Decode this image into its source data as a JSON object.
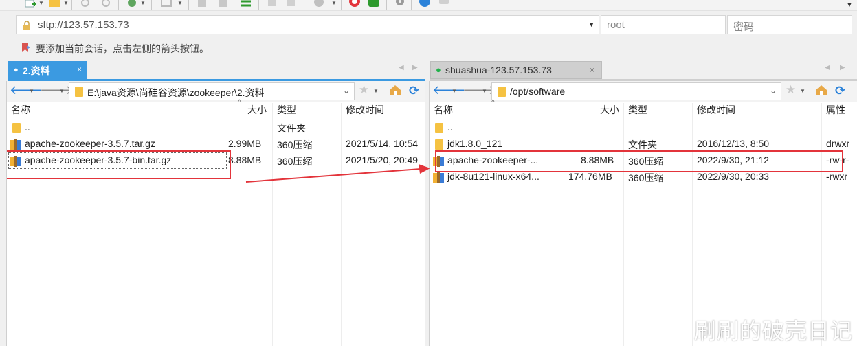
{
  "session": {
    "address": "sftp://123.57.153.73",
    "user_placeholder": "root",
    "password_placeholder": "密码",
    "hint": "要添加当前会话，点击左侧的箭头按钮。"
  },
  "tabs": {
    "left": {
      "label": "2.资料",
      "close": "×"
    },
    "right": {
      "label": "shuashua-123.57.153.73",
      "close": "×"
    }
  },
  "left_pane": {
    "path": "E:\\java资源\\尚硅谷资源\\zookeeper\\2.资料",
    "columns": {
      "name": "名称",
      "size": "大小",
      "type": "类型",
      "modified": "修改时间"
    },
    "rows": [
      {
        "name": "..",
        "size": "",
        "type": "文件夹",
        "modified": "",
        "icon": "folder"
      },
      {
        "name": "apache-zookeeper-3.5.7.tar.gz",
        "size": "2.99MB",
        "type": "360压缩",
        "modified": "2021/5/14, 10:54",
        "icon": "archive"
      },
      {
        "name": "apache-zookeeper-3.5.7-bin.tar.gz",
        "size": "8.88MB",
        "type": "360压缩",
        "modified": "2021/5/20, 20:49",
        "icon": "archive"
      }
    ]
  },
  "right_pane": {
    "path": "/opt/software",
    "columns": {
      "name": "名称",
      "size": "大小",
      "type": "类型",
      "modified": "修改时间",
      "attrs": "属性"
    },
    "rows": [
      {
        "name": "..",
        "size": "",
        "type": "",
        "modified": "",
        "attrs": "",
        "icon": "folder"
      },
      {
        "name": "jdk1.8.0_121",
        "size": "",
        "type": "文件夹",
        "modified": "2016/12/13, 8:50",
        "attrs": "drwxr",
        "icon": "folder"
      },
      {
        "name": "apache-zookeeper-...",
        "size": "8.88MB",
        "type": "360压缩",
        "modified": "2022/9/30, 21:12",
        "attrs": "-rw-r-",
        "icon": "archive"
      },
      {
        "name": "jdk-8u121-linux-x64...",
        "size": "174.76MB",
        "type": "360压缩",
        "modified": "2022/9/30, 20:33",
        "attrs": "-rwxr",
        "icon": "archive"
      }
    ]
  },
  "watermark": "刷刷的破壳日记",
  "colors": {
    "accent": "#3b9ae1",
    "highlight_red": "#e3343b",
    "folder": "#f5c242",
    "online_dot": "#21b24b"
  }
}
